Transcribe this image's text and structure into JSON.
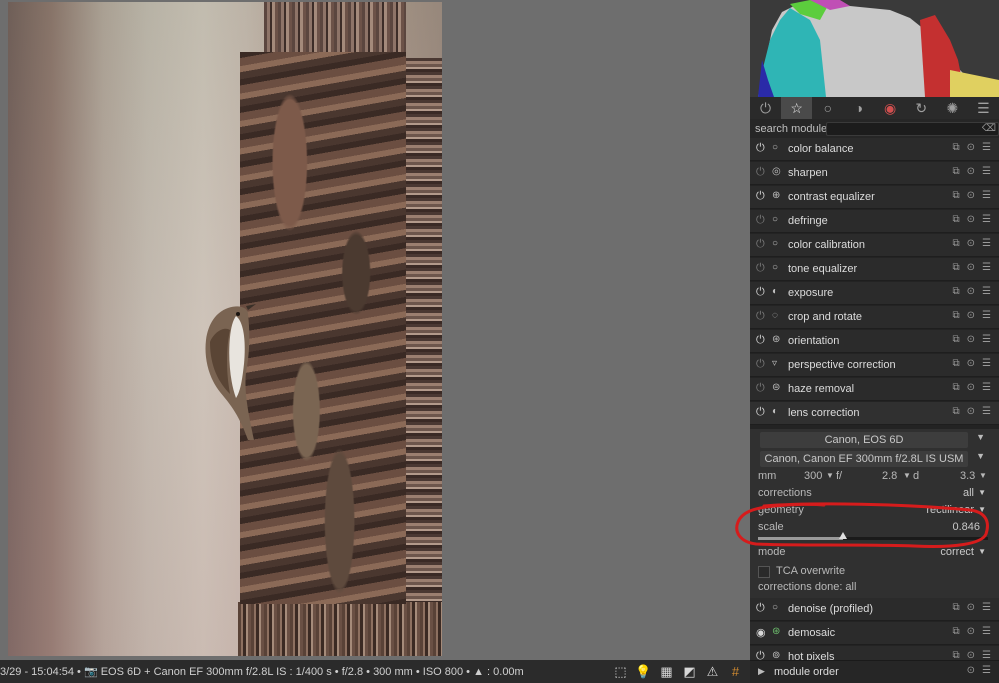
{
  "footer": {
    "info": "3/29 - 15:04:54 • 📷 EOS 6D + Canon EF 300mm f/2.8L IS : 1/400 s • f/2.8 • 300 mm • ISO 800 • ▲ : 0.00m"
  },
  "panel": {
    "search_label": "search module",
    "modules": [
      {
        "name": "color balance",
        "on": true
      },
      {
        "name": "sharpen",
        "on": false
      },
      {
        "name": "contrast equalizer",
        "on": true
      },
      {
        "name": "defringe",
        "on": false
      },
      {
        "name": "color calibration",
        "on": false
      },
      {
        "name": "tone equalizer",
        "on": false
      },
      {
        "name": "exposure",
        "on": true
      },
      {
        "name": "crop and rotate",
        "on": false
      },
      {
        "name": "orientation",
        "on": true
      },
      {
        "name": "perspective correction",
        "on": false
      },
      {
        "name": "haze removal",
        "on": false
      },
      {
        "name": "lens correction",
        "on": true
      }
    ],
    "lens": {
      "camera": "Canon, EOS 6D",
      "lens": "Canon, Canon EF 300mm f/2.8L IS USM",
      "mm_label": "mm",
      "mm_value": "300",
      "f_label": "f/",
      "f_value": "2.8",
      "d_label": "d",
      "d_value": "3.3",
      "corrections_label": "corrections",
      "corrections_value": "all",
      "geometry_label": "geometry",
      "geometry_value": "rectilinear",
      "scale_label": "scale",
      "scale_value": "0.846",
      "scale_fraction": 0.37,
      "mode_label": "mode",
      "mode_value": "correct",
      "tca_label": "TCA overwrite",
      "done_label": "corrections done: all"
    },
    "modules_after": [
      {
        "name": "denoise (profiled)",
        "on": true
      },
      {
        "name": "demosaic",
        "on": true
      },
      {
        "name": "hot pixels",
        "on": true
      }
    ],
    "module_order_label": "module order"
  }
}
